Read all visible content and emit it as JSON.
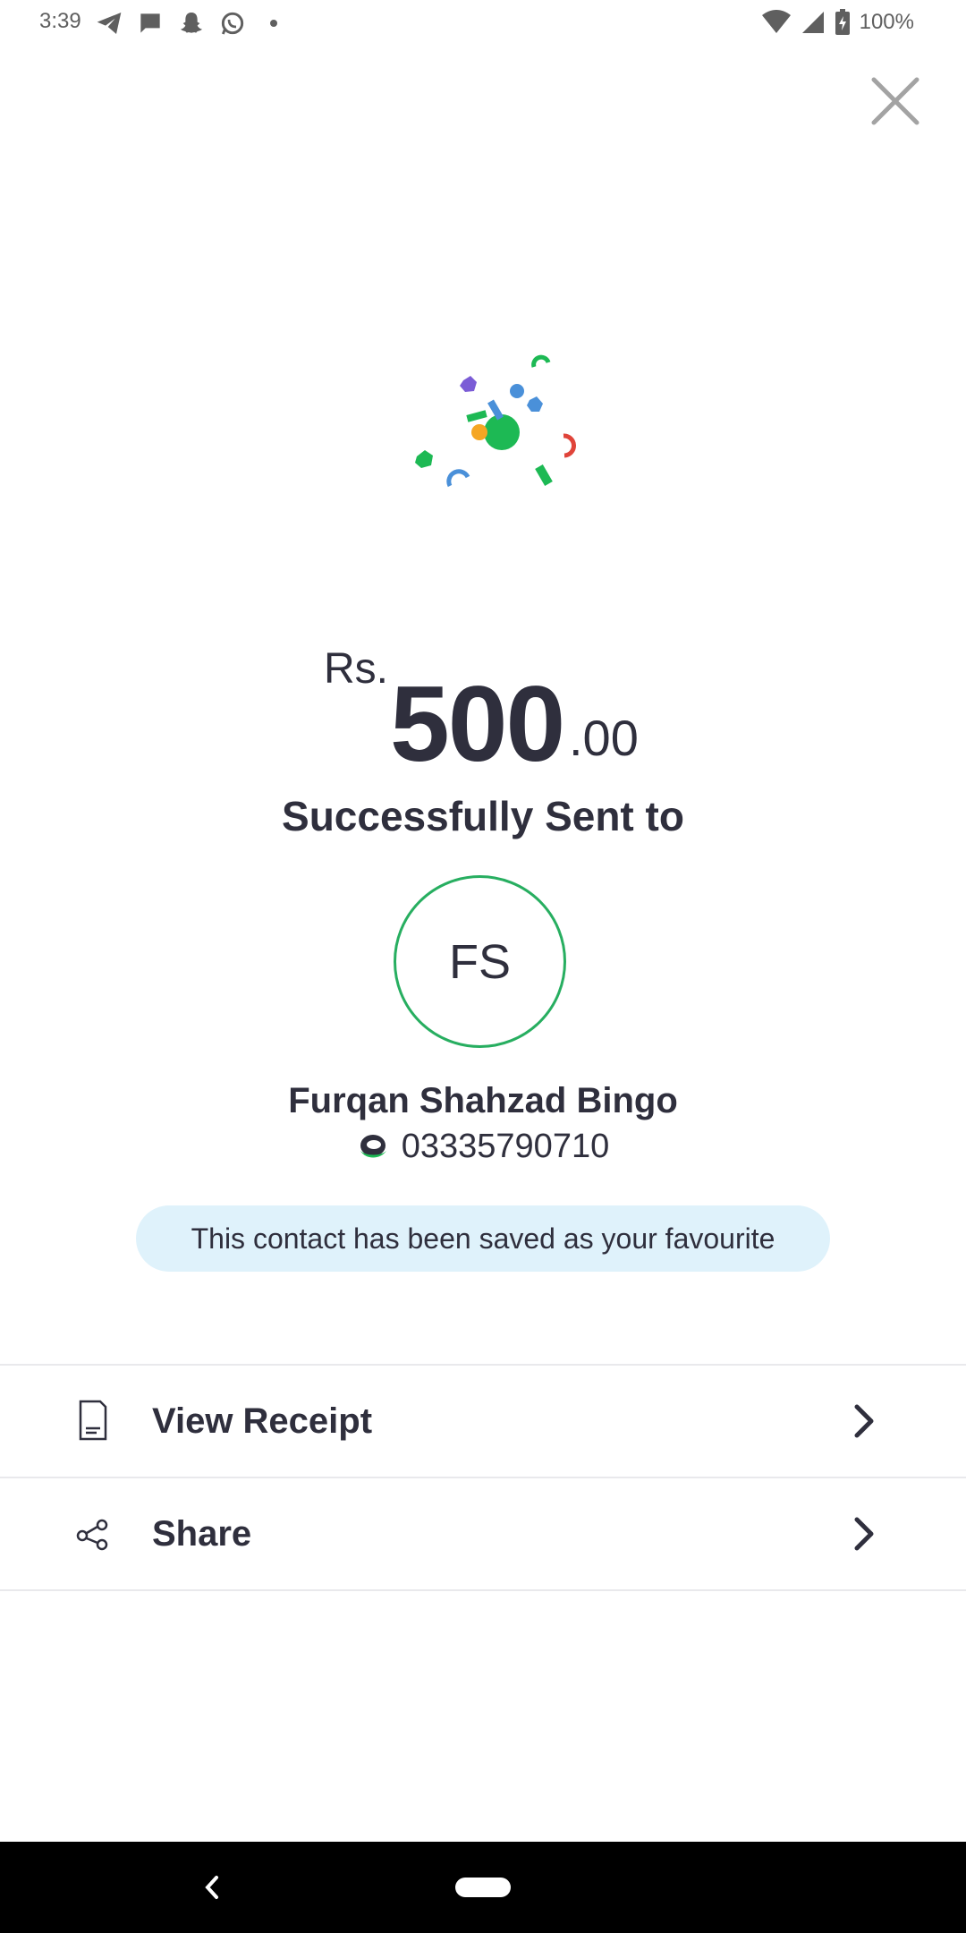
{
  "status_bar": {
    "time": "3:39",
    "battery": "100%",
    "icons_left": [
      "telegram-icon",
      "message-icon",
      "snapchat-icon",
      "whatsapp-icon",
      "dot-icon"
    ],
    "icons_right": [
      "wifi-icon",
      "signal-icon",
      "battery-icon"
    ]
  },
  "header": {
    "close_icon": "close-icon"
  },
  "transaction": {
    "currency": "Rs.",
    "amount_main": "500",
    "amount_decimal": ".00",
    "status_text": "Successfully Sent to"
  },
  "recipient": {
    "initials": "FS",
    "name": "Furqan Shahzad Bingo",
    "phone": "03335790710",
    "wallet_icon": "easypaisa-logo-icon"
  },
  "favourite_note": "This contact has been saved as your favourite",
  "actions": [
    {
      "label": "View Receipt",
      "icon": "receipt-icon"
    },
    {
      "label": "Share",
      "icon": "share-icon"
    }
  ],
  "colors": {
    "accent_green": "#27ae60",
    "pill_background": "#dff2fb",
    "text_dark": "#2f2f3d"
  }
}
